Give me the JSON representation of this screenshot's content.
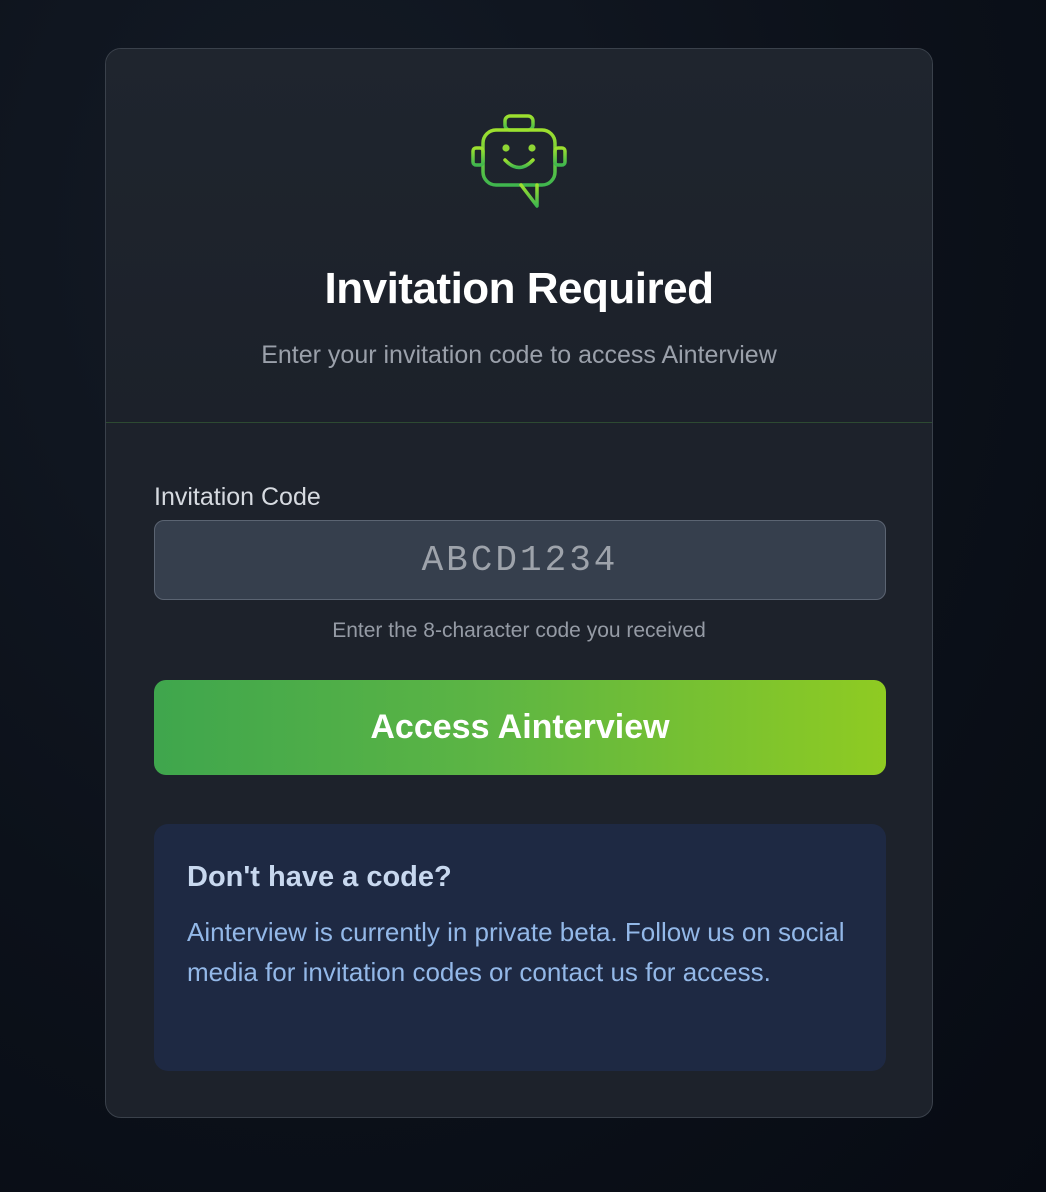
{
  "header": {
    "logo_icon": "robot-chat-icon",
    "title": "Invitation Required",
    "subtitle": "Enter your invitation code to access Ainterview"
  },
  "form": {
    "code_label": "Invitation Code",
    "code_placeholder": "ABCD1234",
    "code_value": "",
    "hint": "Enter the 8-character code you received",
    "submit_label": "Access Ainterview"
  },
  "info": {
    "title": "Don't have a code?",
    "text": "Ainterview is currently in private beta. Follow us on social media for invitation codes or contact us for access."
  },
  "colors": {
    "accent_start": "#3fa64d",
    "accent_end": "#8fcb22",
    "info_background": "#1e2943",
    "info_text": "#93b8e8"
  }
}
